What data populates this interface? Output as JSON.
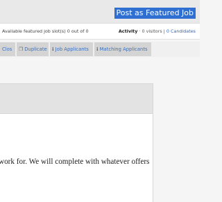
{
  "header": {
    "featured_button": "Post as Featured Job"
  },
  "status": {
    "slots_text": "Available featured job slot(s) 0 out of 0",
    "activity_label": "Activity",
    "visitors_text": "· 0 visitors |",
    "candidates_link": "0 Candidates"
  },
  "toolbar": {
    "close_label": "Clos",
    "duplicate_label": "Duplicate",
    "applicants_label": "Job Applicants",
    "matching_label": "Matching Applicants"
  },
  "content": {
    "body_text": "work for. We will complete with whatever offers"
  },
  "colors": {
    "accent": "#2e6fd1",
    "link": "#2a64c4",
    "tab_bg": "#d4d4d4"
  }
}
